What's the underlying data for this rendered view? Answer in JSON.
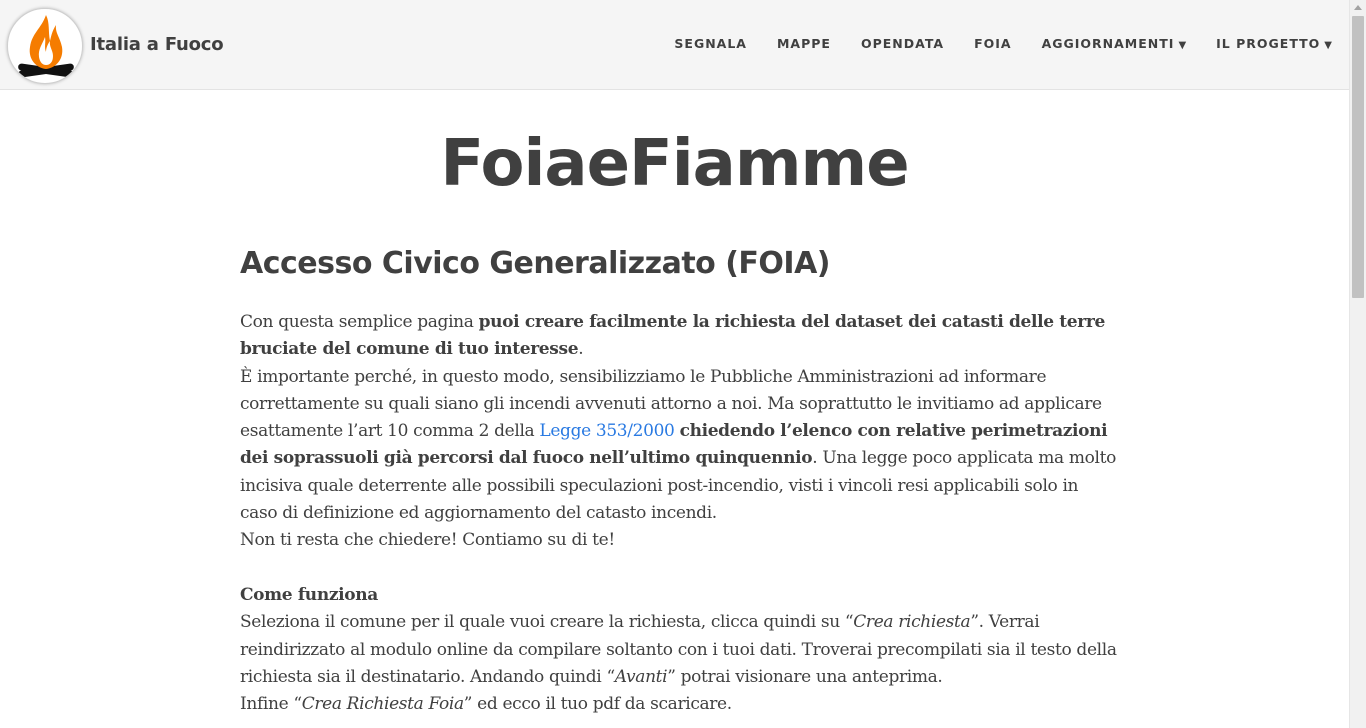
{
  "header": {
    "brand": "Italia a Fuoco",
    "nav": [
      {
        "label": "SEGNALA",
        "dropdown": false
      },
      {
        "label": "MAPPE",
        "dropdown": false
      },
      {
        "label": "OPENDATA",
        "dropdown": false
      },
      {
        "label": "FOIA",
        "dropdown": false
      },
      {
        "label": "AGGIORNAMENTI",
        "dropdown": true
      },
      {
        "label": "IL PROGETTO",
        "dropdown": true
      }
    ],
    "caret": "▼"
  },
  "main": {
    "title": "FoiaeFiamme",
    "heading": "Accesso Civico Generalizzato (FOIA)",
    "intro": {
      "p1_a": "Con questa semplice pagina ",
      "p1_bold": "puoi creare facilmente la richiesta del dataset dei catasti delle terre bruciate del comune di tuo interesse",
      "p1_end": ".",
      "p2_a": "È importante perché, in questo modo, sensibilizziamo le Pubbliche Amministrazioni ad informare correttamente su quali siano gli incendi avvenuti attorno a noi. Ma soprattutto le invitiamo ad applicare esattamente l’art 10 comma 2 della ",
      "p2_link": "Legge 353/2000",
      "p2_b": " ",
      "p2_bold": "chiedendo l’elenco con relative perimetrazioni dei soprassuoli già percorsi dal fuoco nell’ultimo quinquennio",
      "p2_c": ". Una legge poco applicata ma molto incisiva quale deterrente alle possibili speculazioni post-incendio, visti i vincoli resi applicabili solo in caso di definizione ed aggiornamento del catasto incendi.",
      "p3": "Non ti resta che chiedere! Contiamo su di te!"
    },
    "how": {
      "heading": "Come funziona",
      "l1_a": "Seleziona il comune per il quale vuoi creare la richiesta, clicca quindi su “",
      "l1_em": "Crea richiesta",
      "l1_b": "”. Verrai reindirizzato al modulo online da compilare soltanto con i tuoi dati. Troverai precompilati sia il testo della richiesta sia il destinatario. Andando quindi “",
      "l1_em2": "Avanti",
      "l1_c": "” potrai visionare una anteprima.",
      "l2_a": "Infine “",
      "l2_em": "Crea Richiesta Foia",
      "l2_b": "” ed ecco il tuo pdf da scaricare."
    }
  },
  "colors": {
    "navbar_bg": "#f5f5f5",
    "text": "#404040",
    "link": "#2a7ae2",
    "logo_flame": "#f57c00"
  },
  "icons": {
    "logo": "flame-logo-icon"
  }
}
